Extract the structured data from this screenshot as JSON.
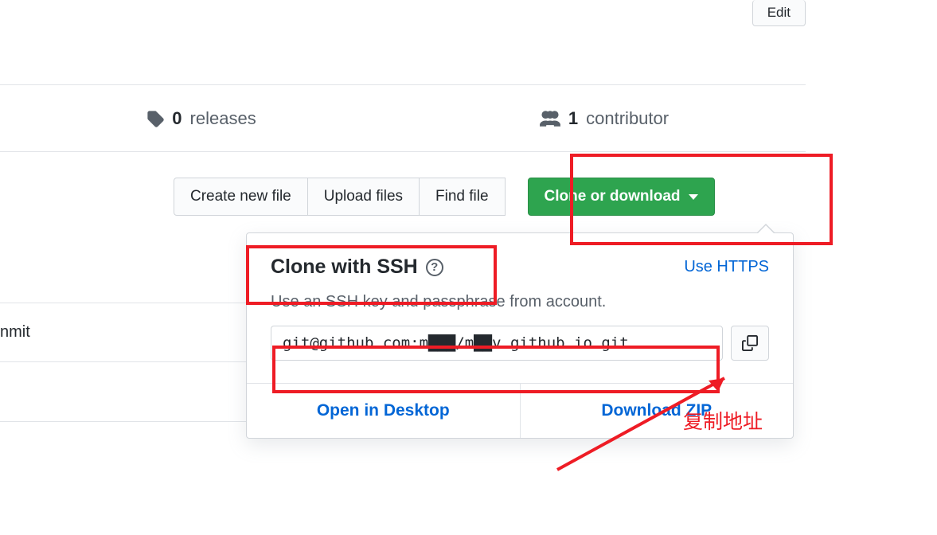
{
  "edit_label": "Edit",
  "stats": {
    "releases_count": "0",
    "releases_label": "releases",
    "contributors_count": "1",
    "contributors_label": "contributor"
  },
  "toolbar": {
    "create_file": "Create new file",
    "upload_files": "Upload files",
    "find_file": "Find file",
    "clone_download": "Clone or download"
  },
  "left_row": "nmit",
  "dropdown": {
    "title": "Clone with SSH",
    "use_https": "Use HTTPS",
    "desc": "Use an SSH key and passphrase from account.",
    "url": "git@github.com:m███/m██v.github.io.git",
    "open_desktop": "Open in Desktop",
    "download_zip": "Download ZIP"
  },
  "annotation": "复制地址"
}
